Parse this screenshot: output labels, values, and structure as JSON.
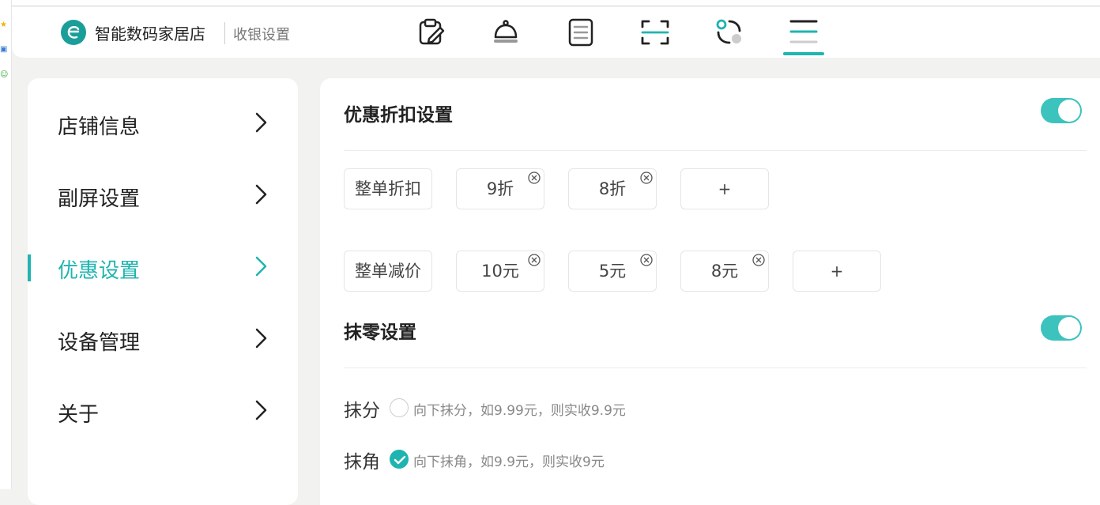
{
  "header": {
    "store_name": "智能数码家居店",
    "page_name": "收银设置"
  },
  "nav_icons": [
    "edit-note-icon",
    "service-bell-icon",
    "document-list-icon",
    "scan-icon",
    "data-nodes-icon",
    "menu-icon"
  ],
  "accent_color": "#1fb4b0",
  "sidebar": {
    "items": [
      {
        "label": "店铺信息"
      },
      {
        "label": "副屏设置"
      },
      {
        "label": "优惠设置",
        "active": true
      },
      {
        "label": "设备管理"
      },
      {
        "label": "关于"
      }
    ]
  },
  "discount": {
    "title": "优惠折扣设置",
    "enabled": true,
    "whole_discount": {
      "label": "整单折扣",
      "values": [
        "9折",
        "8折"
      ],
      "add_label": "+"
    },
    "whole_reduction": {
      "label": "整单减价",
      "values": [
        "10元",
        "5元",
        "8元"
      ],
      "add_label": "+"
    }
  },
  "rounding": {
    "title": "抹零设置",
    "enabled": true,
    "options": [
      {
        "label": "抹分",
        "desc": "向下抹分，如9.99元，则实收9.9元",
        "checked": false
      },
      {
        "label": "抹角",
        "desc": "向下抹角，如9.9元，则实收9元",
        "checked": true
      }
    ]
  }
}
